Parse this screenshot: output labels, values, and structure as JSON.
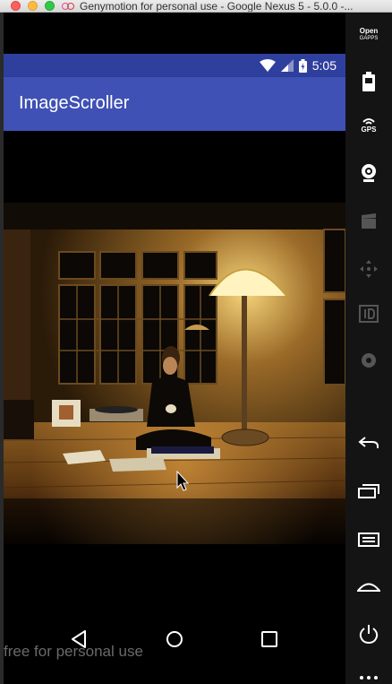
{
  "window": {
    "title": "Genymotion for personal use - Google Nexus 5 - 5.0.0 -..."
  },
  "status_bar": {
    "time": "5:05"
  },
  "app": {
    "title": "ImageScroller"
  },
  "photo": {
    "icon": "photo-image"
  },
  "watermark": {
    "text": "free for personal use"
  },
  "nav": {
    "back_icon": "back-triangle",
    "home_icon": "home-circle",
    "recents_icon": "recents-square"
  },
  "toolbar": {
    "opengapps_line1": "Open",
    "opengapps_line2": "GAPPS",
    "gps_label": "GPS"
  },
  "colors": {
    "status_bar": "#2f3f9e",
    "app_bar": "#3f51b5",
    "toolbar": "#141414"
  }
}
